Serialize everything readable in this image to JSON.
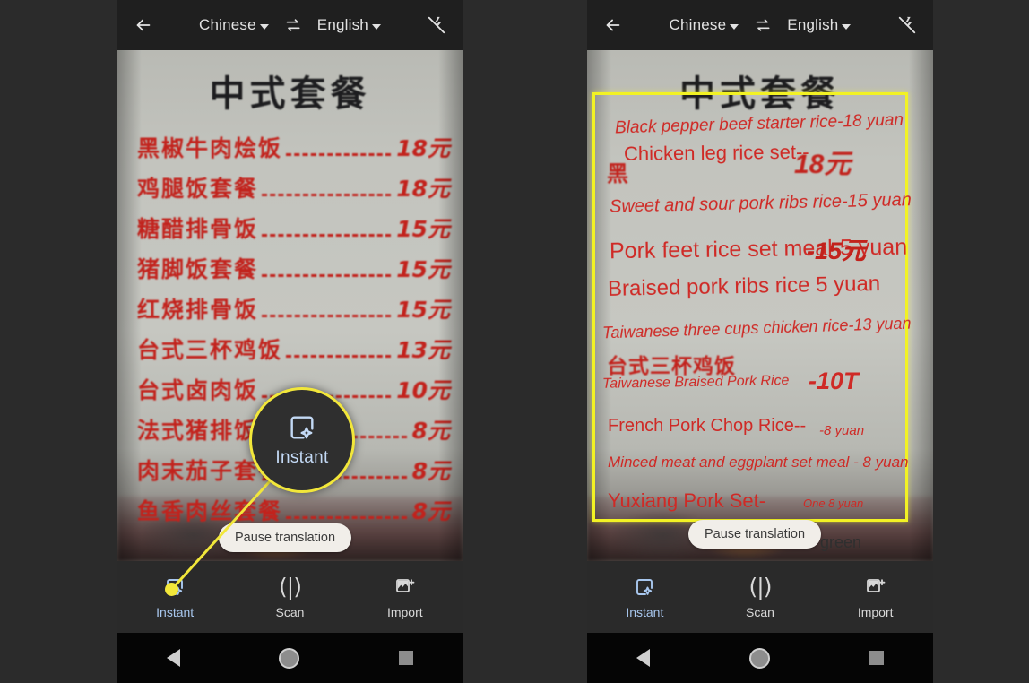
{
  "app": {
    "background_color": "#2b2b2b",
    "accent_yellow": "#f2e73a",
    "accent_blue": "#a8c7ee"
  },
  "topbar": {
    "back_icon": "arrow-left-icon",
    "source_language": "Chinese",
    "swap_icon": "swap-horizontal-icon",
    "target_language": "English",
    "flash_icon": "flash-off-icon"
  },
  "menu_photo": {
    "title": "中式套餐",
    "rows": [
      {
        "name": "黑椒牛肉烩饭",
        "price": "18元"
      },
      {
        "name": "鸡腿饭套餐",
        "price": "18元"
      },
      {
        "name": "糖醋排骨饭",
        "price": "15元"
      },
      {
        "name": "猪脚饭套餐",
        "price": "15元"
      },
      {
        "name": "红烧排骨饭",
        "price": "15元"
      },
      {
        "name": "台式三杯鸡饭",
        "price": "13元"
      },
      {
        "name": "台式卤肉饭",
        "price": "10元"
      },
      {
        "name": "法式猪排饭",
        "price": "8元"
      },
      {
        "name": "肉末茄子套餐",
        "price": "8元"
      },
      {
        "name": "鱼香肉丝套餐",
        "price": "8元"
      }
    ]
  },
  "translated_overlay": {
    "border_color": "#f2f224",
    "lines": [
      "Black pepper beef starter rice-18 yuan",
      "Chicken leg rice set--",
      "Sweet and sour pork ribs rice-15 yuan",
      "Pork feet rice set meal-5 yuan",
      "Braised pork ribs rice 5 yuan",
      "Taiwanese three cups chicken rice-13 yuan",
      "Taiwanese Braised Pork Rice",
      "French Pork Chop Rice--",
      "Minced meat and eggplant set meal - 8 yuan",
      "Yuxiang Pork Set-"
    ],
    "residual_text": [
      "18元",
      "黑",
      "-15元",
      "台式三杯鸡饭",
      "-10T",
      "-8 yuan",
      "One 8 yuan"
    ],
    "outside_text": "green"
  },
  "pause_pill": {
    "label": "Pause translation"
  },
  "callout": {
    "icon": "instant-translate-icon",
    "label": "Instant"
  },
  "modebar": {
    "items": [
      {
        "label": "Instant",
        "icon": "instant-translate-icon",
        "active": true
      },
      {
        "label": "Scan",
        "icon": "scan-brackets-icon",
        "active": false
      },
      {
        "label": "Import",
        "icon": "import-image-icon",
        "active": false
      }
    ]
  },
  "navbar": {
    "back": "back-triangle-icon",
    "home": "home-circle-icon",
    "recents": "recents-square-icon"
  }
}
